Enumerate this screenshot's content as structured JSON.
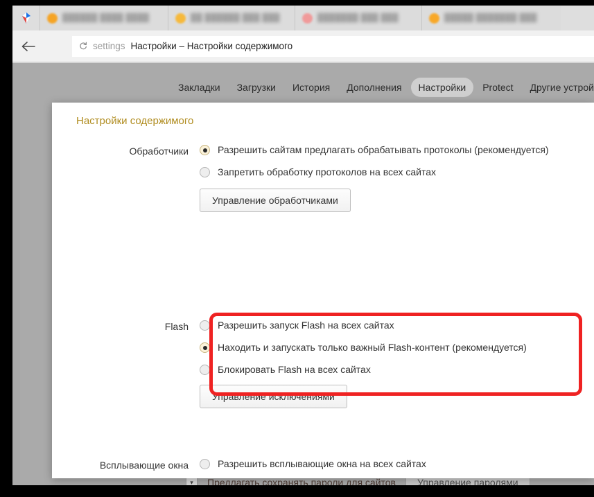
{
  "browser": {
    "logo_icon": "yandex-browser-logo",
    "tabs": [
      {
        "favicon_color": "#f5a425",
        "title": "██████ ████ ████"
      },
      {
        "favicon_color": "#f6b93b",
        "title": "██ ██████ ███ ███"
      },
      {
        "favicon_color": "#f09a9a",
        "title": "███████ ███ ███"
      },
      {
        "favicon_color": "#f8a828",
        "title": "█████ ███████ ███"
      }
    ],
    "back_icon": "back-arrow-icon",
    "ya_logo": "Я",
    "omnibox": {
      "reload_icon": "↻",
      "scheme": "settings",
      "title": "Настройки – Настройки содержимого"
    }
  },
  "nav": {
    "items": [
      {
        "label": "Закладки",
        "active": false
      },
      {
        "label": "Загрузки",
        "active": false
      },
      {
        "label": "История",
        "active": false
      },
      {
        "label": "Дополнения",
        "active": false
      },
      {
        "label": "Настройки",
        "active": true
      },
      {
        "label": "Protect",
        "active": false
      },
      {
        "label": "Другие устройства",
        "active": false
      }
    ]
  },
  "background_row": {
    "checkbox_glyph": "▾",
    "label": "Предлагать сохранять пароли для сайтов",
    "button": "Управление паролями"
  },
  "modal": {
    "title": "Настройки содержимого",
    "handlers": {
      "label": "Обработчики",
      "options": [
        {
          "text": "Разрешить сайтам предлагать обрабатывать протоколы (рекомендуется)",
          "checked": true
        },
        {
          "text": "Запретить обработку протоколов на всех сайтах",
          "checked": false
        }
      ],
      "button": "Управление обработчиками"
    },
    "flash": {
      "label": "Flash",
      "options": [
        {
          "text": "Разрешить запуск Flash на всех сайтах",
          "checked": false
        },
        {
          "text": "Находить и запускать только важный Flash-контент (рекомендуется)",
          "checked": true
        },
        {
          "text": "Блокировать Flash на всех сайтах",
          "checked": false
        }
      ],
      "button": "Управление исключениями",
      "highlight_color": "#ef2222"
    },
    "popups": {
      "label": "Всплывающие окна",
      "options": [
        {
          "text": "Разрешить всплывающие окна на всех сайтах",
          "checked": false
        }
      ]
    }
  }
}
